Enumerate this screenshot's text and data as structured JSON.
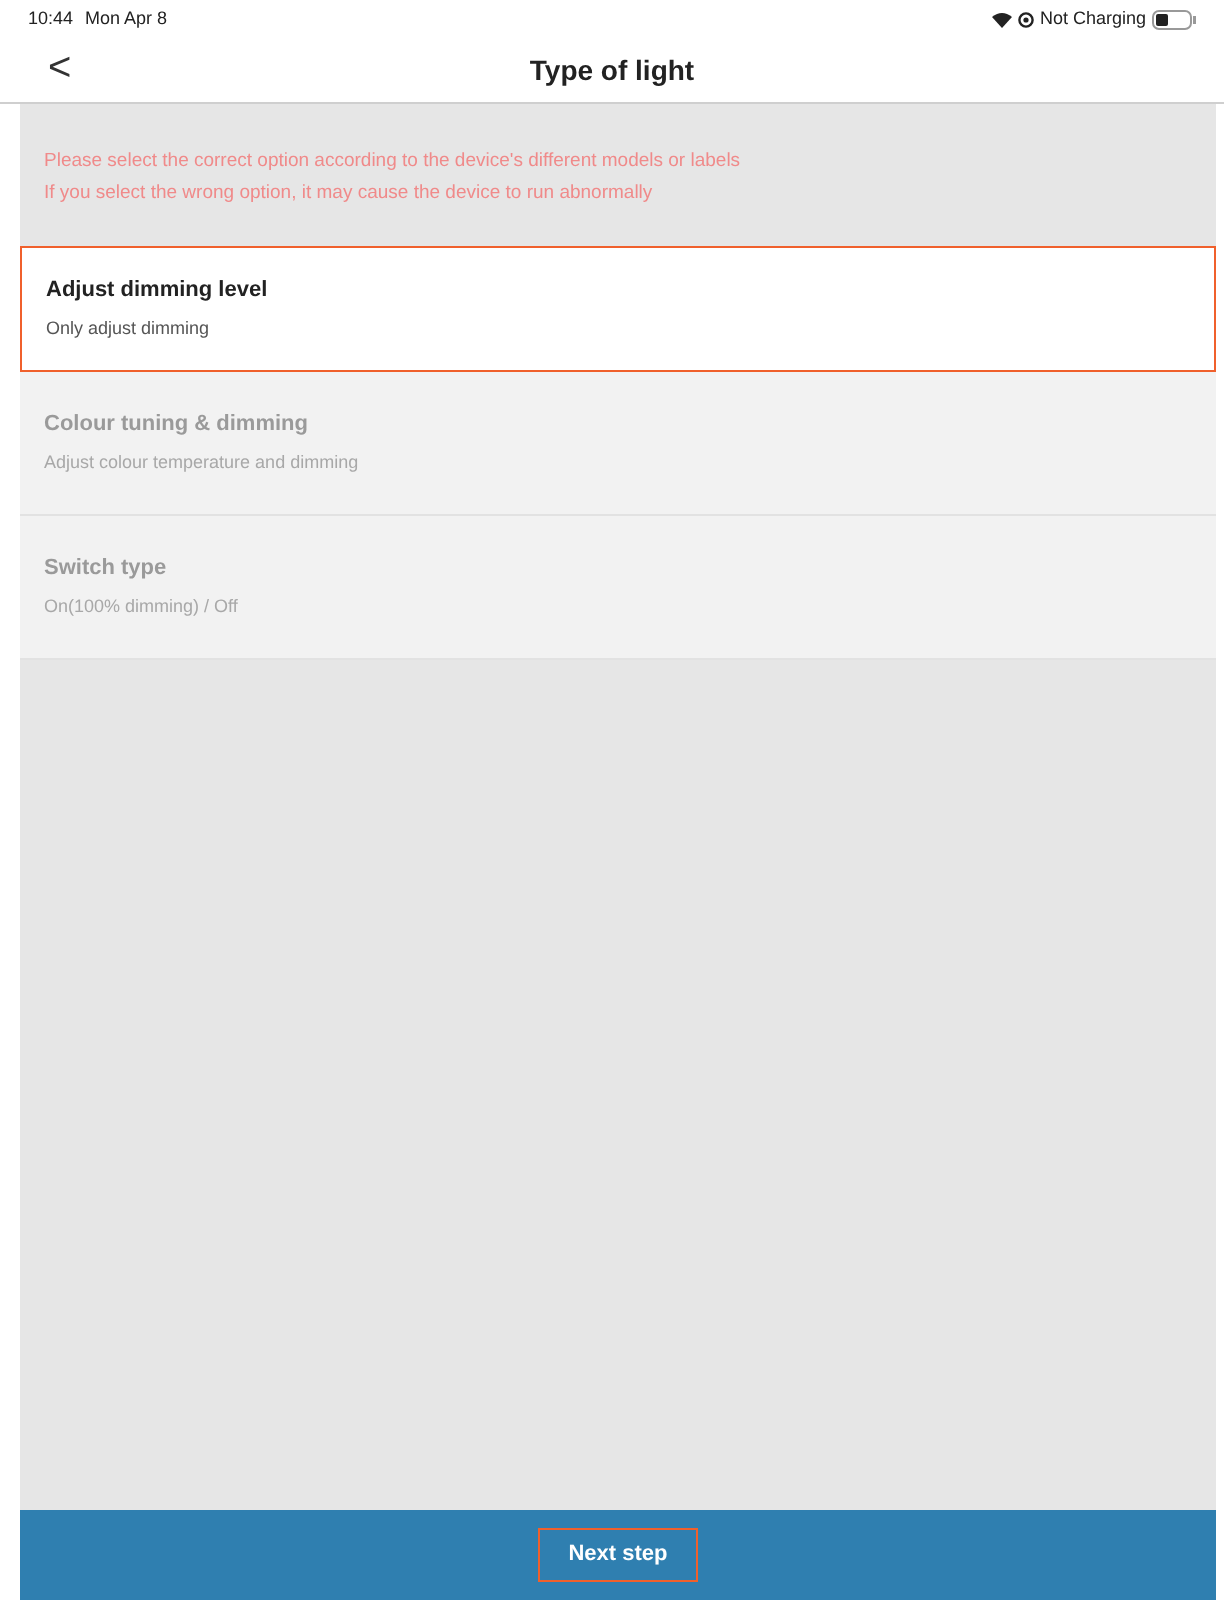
{
  "status_bar": {
    "time": "10:44",
    "date": "Mon Apr 8",
    "battery_text": "Not Charging"
  },
  "nav": {
    "back": "<",
    "title": "Type of light"
  },
  "warning": [
    "Please select the correct option according to the device's different models or labels",
    "If you select the wrong option, it may cause the device to run abnormally"
  ],
  "options": [
    {
      "title": "Adjust dimming level",
      "subtitle": "Only adjust dimming",
      "selected": true
    },
    {
      "title": "Colour tuning & dimming",
      "subtitle": "Adjust colour temperature and dimming",
      "selected": false
    },
    {
      "title": "Switch type",
      "subtitle": "On(100% dimming) / Off",
      "selected": false
    }
  ],
  "next_button": {
    "label": "Next step",
    "highlighted": true
  }
}
